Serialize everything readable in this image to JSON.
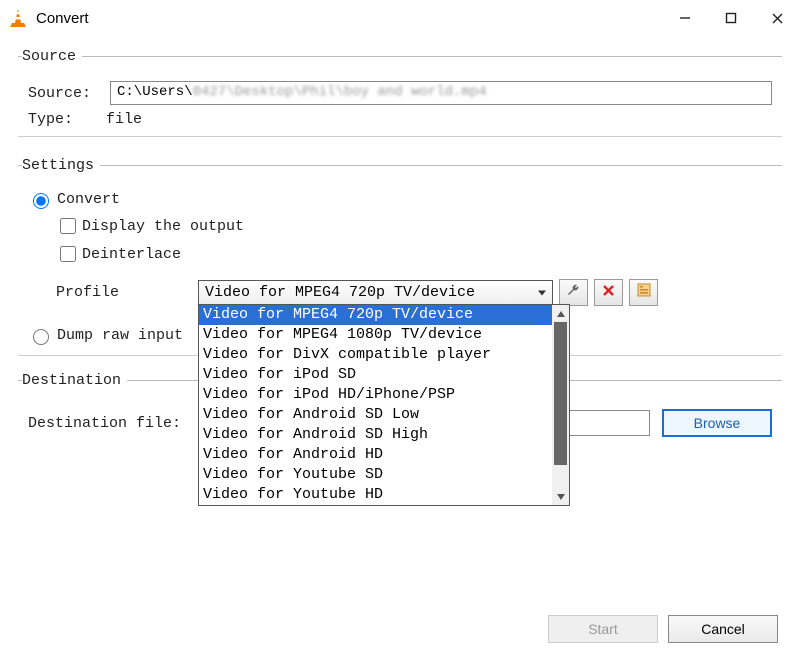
{
  "window": {
    "title": "Convert",
    "buttons": {
      "minimize": "Minimize",
      "maximize": "Maximize",
      "close": "Close"
    }
  },
  "source_group": {
    "legend": "Source",
    "source_label": "Source:",
    "source_value_visible": "C:\\Users\\",
    "source_value_blurred": "0427\\Desktop\\Phil\\boy and world.mp4",
    "type_label": "Type:",
    "type_value": "file"
  },
  "settings_group": {
    "legend": "Settings",
    "convert_label": "Convert",
    "display_output_label": "Display the output",
    "deinterlace_label": "Deinterlace",
    "profile_label": "Profile",
    "profile_selected": "Video for MPEG4 720p TV/device",
    "profile_options": [
      "Video for MPEG4 720p TV/device",
      "Video for MPEG4 1080p TV/device",
      "Video for DivX compatible player",
      "Video for iPod SD",
      "Video for iPod HD/iPhone/PSP",
      "Video for Android SD Low",
      "Video for Android SD High",
      "Video for Android HD",
      "Video for Youtube SD",
      "Video for Youtube HD"
    ],
    "dump_raw_label": "Dump raw input"
  },
  "destination_group": {
    "legend": "Destination",
    "destination_label": "Destination file:",
    "browse_label": "Browse"
  },
  "footer": {
    "start_label": "Start",
    "cancel_label": "Cancel"
  }
}
